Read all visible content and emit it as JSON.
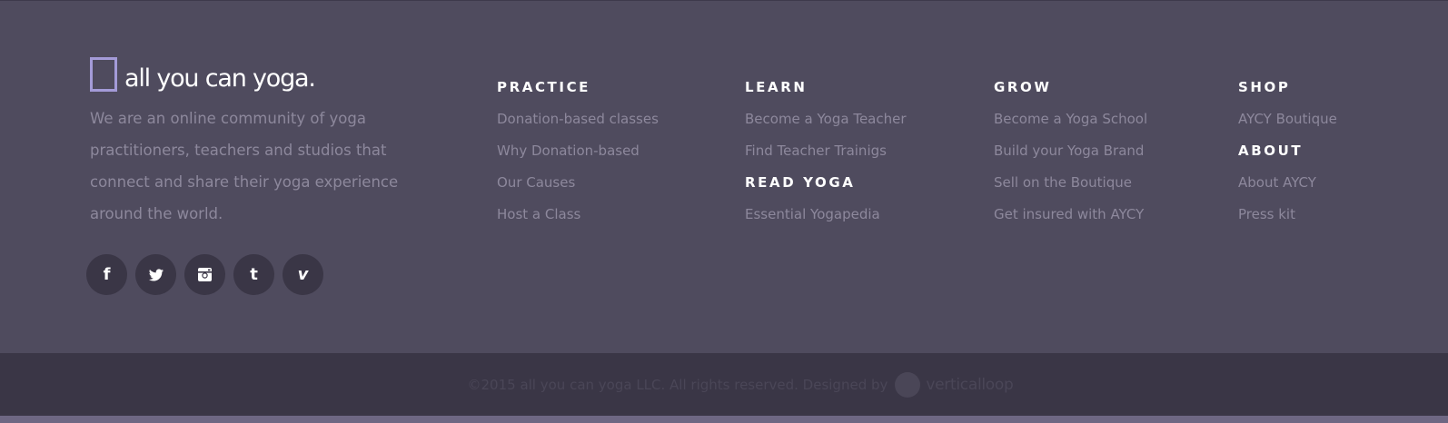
{
  "brand": {
    "logo_text": "all you can yoga.",
    "tagline": "We are an online community of yoga practitioners, teachers and studios that connect and share their yoga experience around the world."
  },
  "social": [
    {
      "name": "facebook-icon",
      "glyph": "f"
    },
    {
      "name": "twitter-icon",
      "glyph": "bird"
    },
    {
      "name": "instagram-icon",
      "glyph": "camera"
    },
    {
      "name": "tumblr-icon",
      "glyph": "t"
    },
    {
      "name": "vimeo-icon",
      "glyph": "v"
    }
  ],
  "columns": {
    "practice": {
      "heading": "PRACTICE",
      "links": [
        "Donation-based classes",
        "Why Donation-based",
        "Our Causes",
        "Host a Class"
      ]
    },
    "learn": {
      "heading": "LEARN",
      "links": [
        "Become a Yoga Teacher",
        "Find Teacher Trainigs"
      ],
      "sub_heading": "READ YOGA",
      "sub_links": [
        "Essential Yogapedia"
      ]
    },
    "grow": {
      "heading": "GROW",
      "links": [
        "Become a Yoga School",
        "Build your Yoga Brand",
        "Sell on the Boutique",
        "Get insured with AYCY"
      ]
    },
    "shop": {
      "heading": "SHOP",
      "links": [
        "AYCY Boutique"
      ],
      "sub_heading": "ABOUT",
      "sub_links": [
        "About AYCY",
        "Press kit"
      ]
    }
  },
  "footer": {
    "copyright": "©2015 all you can yoga LLC. All rights reserved. Designed by",
    "designer": "verticalloop"
  },
  "colors": {
    "background": "#4f4b5e",
    "bottom_bar": "#3a3646",
    "link": "#8d889c",
    "heading": "#ffffff",
    "logo_accent": "#a49bd8"
  }
}
